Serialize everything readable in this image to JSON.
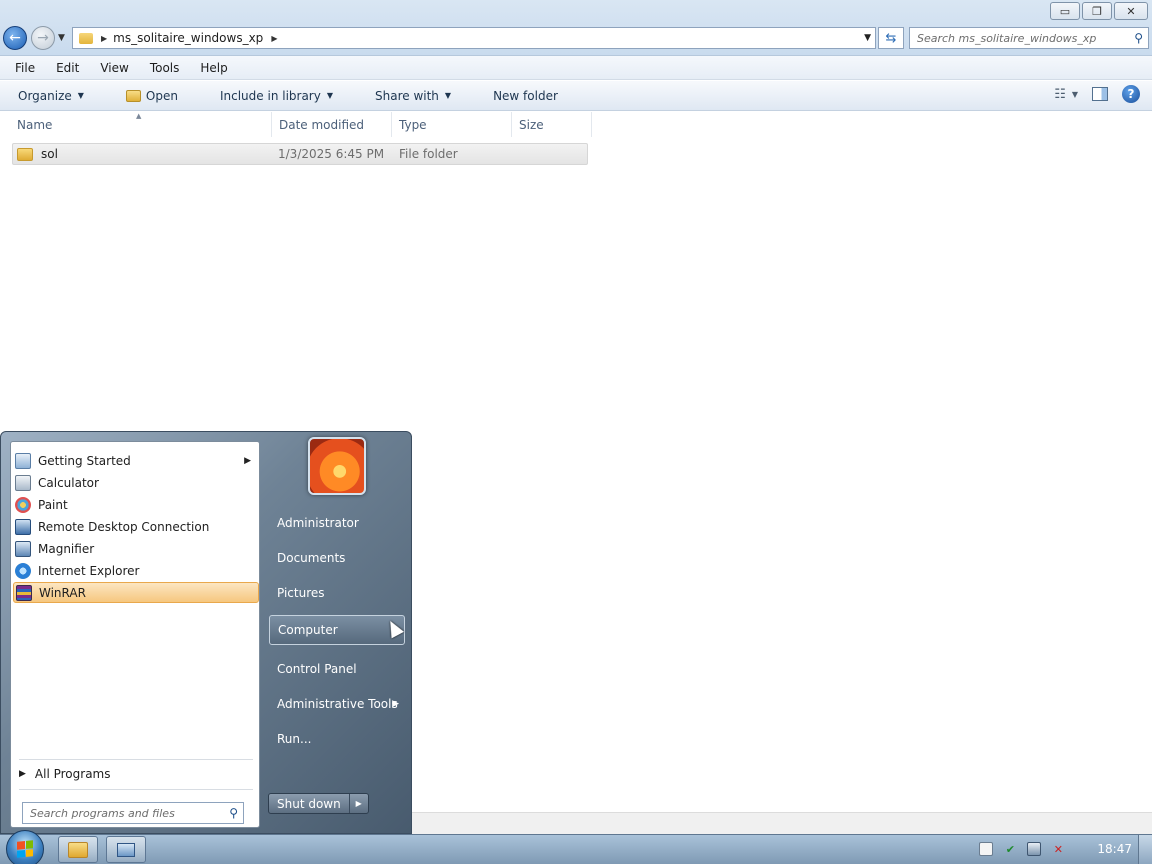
{
  "window": {
    "address": {
      "path": "ms_solitaire_windows_xp"
    },
    "search_placeholder": "Search ms_solitaire_windows_xp"
  },
  "menubar": [
    "File",
    "Edit",
    "View",
    "Tools",
    "Help"
  ],
  "command_bar": {
    "organize": "Organize",
    "open": "Open",
    "include_in_library": "Include in library",
    "share_with": "Share with",
    "new_folder": "New folder"
  },
  "columns": [
    "Name",
    "Date modified",
    "Type",
    "Size"
  ],
  "files": [
    {
      "name": "sol",
      "date_modified": "1/3/2025 6:45 PM",
      "type": "File folder",
      "size": ""
    }
  ],
  "start_menu": {
    "programs": [
      {
        "label": "Getting Started",
        "icon": "getting-started-icon",
        "submenu": true
      },
      {
        "label": "Calculator",
        "icon": "calculator-icon",
        "submenu": false
      },
      {
        "label": "Paint",
        "icon": "paint-icon",
        "submenu": false
      },
      {
        "label": "Remote Desktop Connection",
        "icon": "remote-desktop-icon",
        "submenu": false
      },
      {
        "label": "Magnifier",
        "icon": "magnifier-icon",
        "submenu": false
      },
      {
        "label": "Internet Explorer",
        "icon": "internet-explorer-icon",
        "submenu": false
      },
      {
        "label": "WinRAR",
        "icon": "winrar-icon",
        "submenu": false,
        "highlighted": true
      }
    ],
    "all_programs": "All Programs",
    "search_placeholder": "Search programs and files",
    "right_links": [
      "Administrator",
      "Documents",
      "Pictures",
      "Computer",
      "Control Panel",
      "Administrative Tools",
      "Run..."
    ],
    "hovered_link": "Computer",
    "shutdown": "Shut down"
  },
  "taskbar": {
    "clock": "18:47"
  },
  "colors": {
    "highlight": "#f6c77f",
    "start_menu_panel": "#5b6e82",
    "taskbar": "#93aec7"
  }
}
